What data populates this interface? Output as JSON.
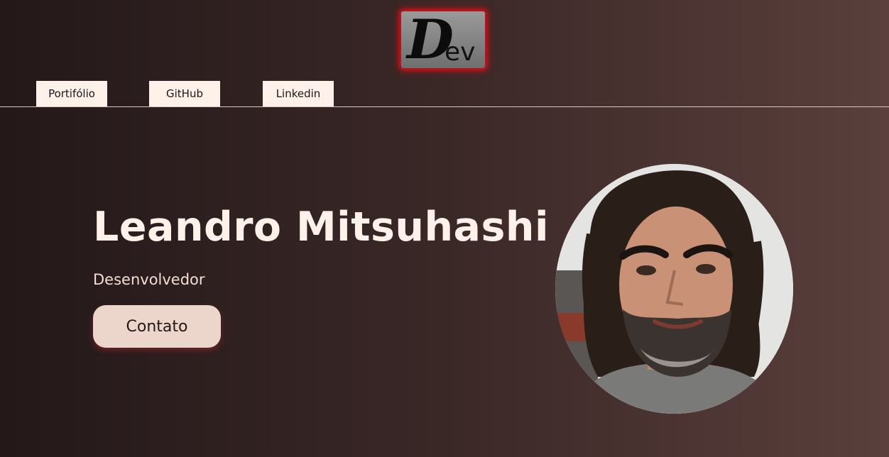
{
  "logo": {
    "letter": "D",
    "rest": "ev",
    "glow_color": "#d0101a"
  },
  "nav": {
    "items": [
      {
        "label": "Portifólio"
      },
      {
        "label": "GitHub"
      },
      {
        "label": "Linkedin"
      }
    ]
  },
  "hero": {
    "name": "Leandro Mitsuhashi",
    "role": "Desenvolvedor",
    "contact_label": "Contato"
  },
  "avatar": {
    "icon": "profile-photo"
  },
  "colors": {
    "background_start": "#241819",
    "background_end": "#5a3f3c",
    "nav_bg": "#fdf1ea",
    "name_text": "#fdf1ea",
    "button_bg": "#ecd6cb"
  }
}
